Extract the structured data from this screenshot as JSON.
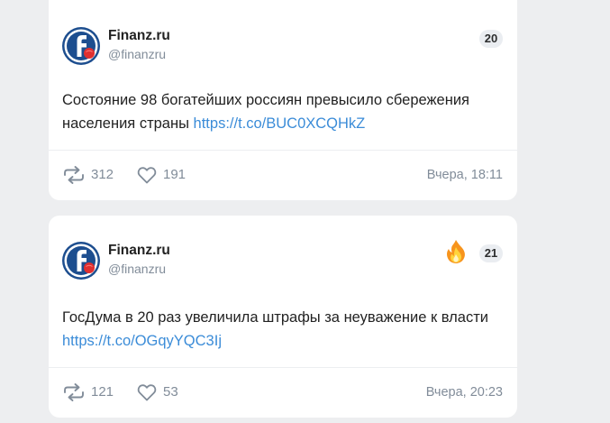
{
  "posts": [
    {
      "author": "Finanz.ru",
      "handle": "@finanzru",
      "counter": "20",
      "text": "Состояние 98 богатейших россиян превысило сбережения населения страны",
      "link": "https://t.co/BUC0XCQHkZ",
      "reposts": "312",
      "likes": "191",
      "time": "Вчера, 18:11",
      "hot": false
    },
    {
      "author": "Finanz.ru",
      "handle": "@finanzru",
      "counter": "21",
      "text": "ГосДума в 20 раз увеличила штрафы за неуважение к власти",
      "link": "https://t.co/OGqyYQC3Ij",
      "reposts": "121",
      "likes": "53",
      "time": "Вчера, 20:23",
      "hot": true
    }
  ],
  "icons": {
    "avatar": "finanz-logo",
    "repost": "repost-icon",
    "like": "heart-icon",
    "hot": "fire-icon"
  },
  "colors": {
    "background": "#edeef0",
    "card": "#ffffff",
    "link": "#3b8cd8",
    "secondary_text": "#818c99",
    "logo_blue": "#1d4e8f",
    "logo_red": "#e03030"
  }
}
